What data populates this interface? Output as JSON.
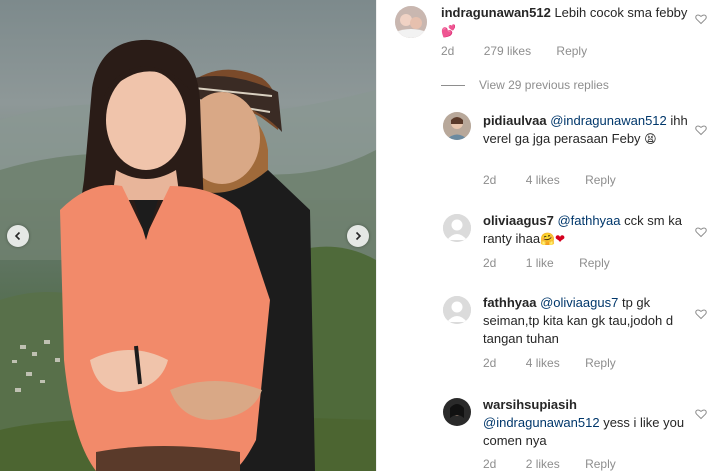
{
  "post": {
    "photo": {
      "description_icon": "photo-couple"
    },
    "carousel": {
      "prev_icon": "chevron-left-icon",
      "next_icon": "chevron-right-icon"
    }
  },
  "comments": {
    "top": {
      "username": "indragunawan512",
      "text": "Lebih cocok sma febby",
      "emoji": "💕",
      "time": "2d",
      "likes": "279 likes",
      "reply": "Reply"
    },
    "view_replies": "View 29 previous replies",
    "replies": [
      {
        "username": "pidiaulvaa",
        "mention": "@indragunawan512",
        "text": "ihh verel ga jga perasaan Feby",
        "emoji": "😫",
        "time": "2d",
        "likes": "4 likes",
        "reply": "Reply"
      },
      {
        "username": "oliviaagus7",
        "mention": "@fathhyaa",
        "text": "cck sm ka ranty ihaa",
        "emoji": "🤗❤",
        "time": "2d",
        "likes": "1 like",
        "reply": "Reply"
      },
      {
        "username": "fathhyaa",
        "mention": "@oliviaagus7",
        "text": "tp gk seiman,tp kita kan gk tau,jodoh d tangan tuhan",
        "emoji": "",
        "time": "2d",
        "likes": "4 likes",
        "reply": "Reply"
      },
      {
        "username": "warsihsupiasih",
        "mention": "@indragunawan512",
        "text": "yess i like you comen nya",
        "emoji": "",
        "time": "2d",
        "likes": "2 likes",
        "reply": "Reply"
      }
    ]
  },
  "colors": {
    "mention": "#00376b",
    "meta": "#8e8e8e",
    "text": "#262626"
  }
}
